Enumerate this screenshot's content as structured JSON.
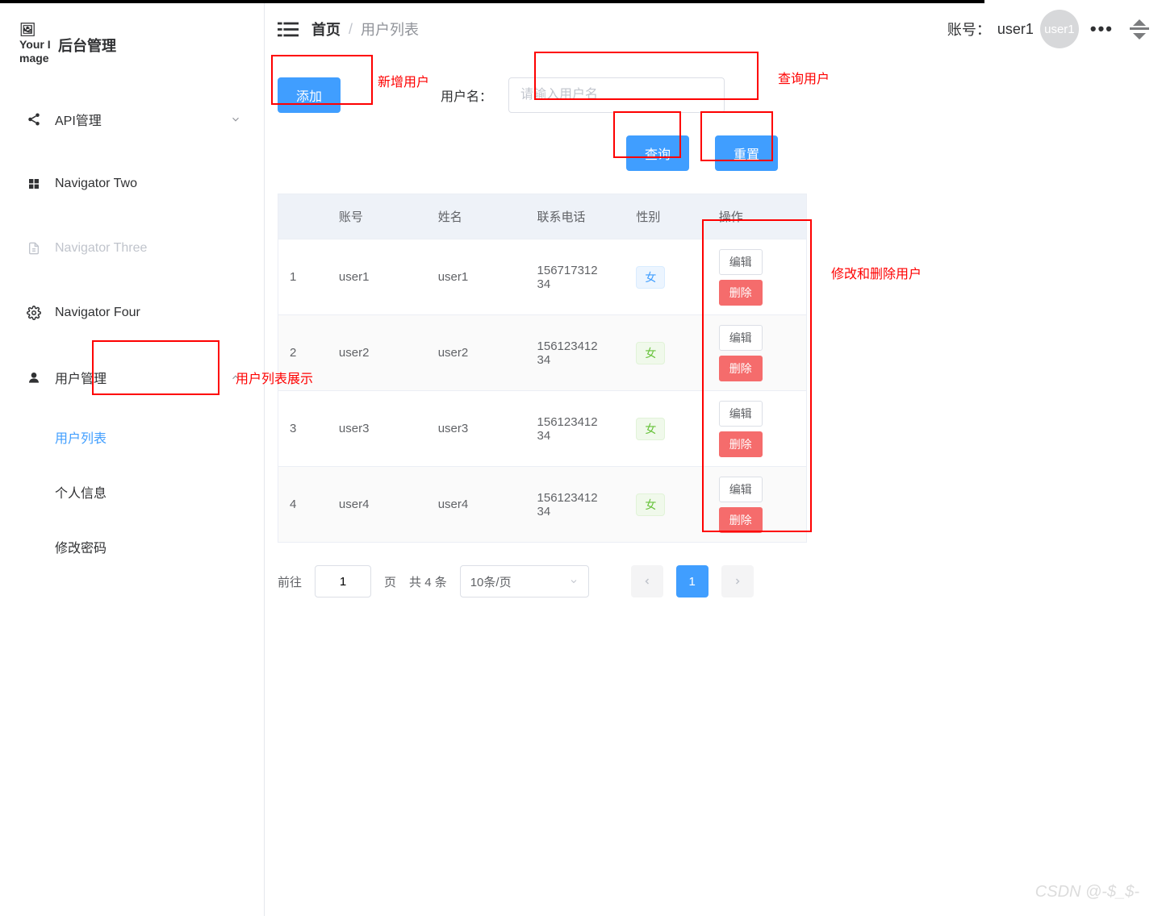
{
  "app_title": "后台管理",
  "broken_img_alt": "Your Image",
  "sidebar": {
    "items": [
      {
        "label": "API管理",
        "has_arrow": true,
        "expanded": false
      },
      {
        "label": "Navigator Two"
      },
      {
        "label": "Navigator Three",
        "disabled": true
      },
      {
        "label": "Navigator Four"
      },
      {
        "label": "用户管理",
        "has_arrow": true,
        "expanded": true
      }
    ],
    "submenu": [
      {
        "label": "用户列表",
        "active": true
      },
      {
        "label": "个人信息"
      },
      {
        "label": "修改密码"
      }
    ]
  },
  "breadcrumb": {
    "home": "首页",
    "sep": "/",
    "current": "用户列表"
  },
  "topbar": {
    "account_label": "账号：",
    "account_value": "user1",
    "avatar_text": "user1"
  },
  "toolbar": {
    "add_label": "添加",
    "username_label": "用户名：",
    "username_placeholder": "请输入用户名",
    "search_label": "查询",
    "reset_label": "重置"
  },
  "table": {
    "columns": [
      "",
      "账号",
      "姓名",
      "联系电话",
      "性别",
      "操作"
    ],
    "actions": {
      "edit": "编辑",
      "delete": "删除"
    },
    "rows": [
      {
        "idx": "1",
        "account": "user1",
        "name": "user1",
        "phone": "156717312​34",
        "gender": "女",
        "gender_style": "blue"
      },
      {
        "idx": "2",
        "account": "user2",
        "name": "user2",
        "phone": "156123412​34",
        "gender": "女",
        "gender_style": "green"
      },
      {
        "idx": "3",
        "account": "user3",
        "name": "user3",
        "phone": "156123412​34",
        "gender": "女",
        "gender_style": "green"
      },
      {
        "idx": "4",
        "account": "user4",
        "name": "user4",
        "phone": "156123412​34",
        "gender": "女",
        "gender_style": "green"
      }
    ]
  },
  "pagination": {
    "goto_prefix": "前往",
    "goto_suffix": "页",
    "page_value": "1",
    "total_text": "共 4 条",
    "page_size_label": "10条/页",
    "current_page": "1"
  },
  "annotations": {
    "add_user": "新增用户",
    "search_user": "查询用户",
    "list_display": "用户列表展示",
    "edit_delete": "修改和删除用户"
  },
  "watermark": "CSDN @-$_$-"
}
